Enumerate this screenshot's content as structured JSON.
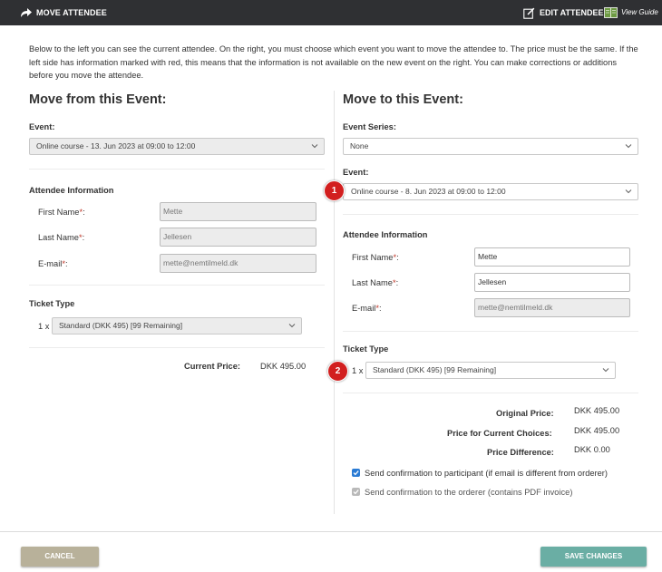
{
  "header": {
    "title": "MOVE ATTENDEE",
    "edit_label": "EDIT ATTENDEE",
    "guide_label": "View Guide"
  },
  "intro": "Below to the left you can see the current attendee. On the right, you must choose which event you want to move the attendee to. The price must be the same. If the left side has information marked with red, this means that the information is not available on the new event on the right. You can make corrections or additions before you move the attendee.",
  "left": {
    "heading": "Move from this Event:",
    "event_label": "Event:",
    "event_value": "Online course - 13. Jun 2023 at 09:00 to 12:00",
    "attendee_heading": "Attendee Information",
    "first_name_label": "First Name",
    "first_name_value": "Mette",
    "last_name_label": "Last Name",
    "last_name_value": "Jellesen",
    "email_label": "E-mail",
    "email_value": "mette@nemtilmeld.dk",
    "ticket_heading": "Ticket Type",
    "ticket_qty": "1 x",
    "ticket_value": "Standard (DKK 495) [99 Remaining]",
    "current_price_label": "Current Price:",
    "current_price_value": "DKK 495.00"
  },
  "right": {
    "heading": "Move to this Event:",
    "series_label": "Event Series:",
    "series_value": "None",
    "event_label": "Event:",
    "event_value": "Online course - 8. Jun 2023 at 09:00 to 12:00",
    "attendee_heading": "Attendee Information",
    "first_name_label": "First Name",
    "first_name_value": "Mette",
    "last_name_label": "Last Name",
    "last_name_value": "Jellesen",
    "email_label": "E-mail",
    "email_value": "mette@nemtilmeld.dk",
    "ticket_heading": "Ticket Type",
    "ticket_qty": "1 x",
    "ticket_value": "Standard (DKK 495) [99 Remaining]",
    "original_price_label": "Original Price:",
    "original_price_value": "DKK 495.00",
    "current_choices_label": "Price for Current Choices:",
    "current_choices_value": "DKK 495.00",
    "difference_label": "Price Difference:",
    "difference_value": "DKK 0.00",
    "confirm_participant": "Send confirmation to participant (if email is different from orderer)",
    "confirm_orderer": "Send confirmation to the orderer (contains PDF invoice)"
  },
  "required_marker": "*",
  "colon": ":",
  "badges": [
    "1",
    "2"
  ],
  "buttons": {
    "cancel": "CANCEL",
    "save": "SAVE CHANGES"
  },
  "colors": {
    "topbar": "#2f3033",
    "badge": "#d21f1f",
    "cancel": "#b8b19a",
    "save": "#6aaea4",
    "checkbox": "#2a7bd4"
  }
}
